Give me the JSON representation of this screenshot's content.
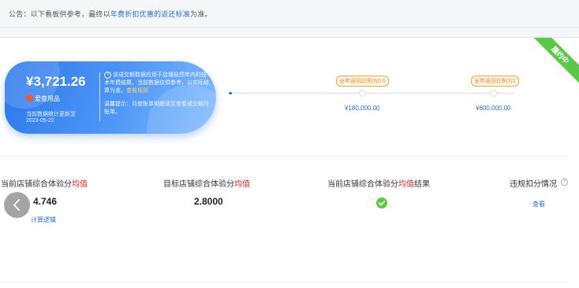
{
  "notice": {
    "prefix": "公告：以下看板供参考，最终以",
    "highlight": "年费折扣优惠的返还标准",
    "suffix": "为准。"
  },
  "ribbon": {
    "label": "履约中"
  },
  "card": {
    "amount": "¥3,721.26",
    "brand": "爱查用品",
    "update_line1": "当前数据统计更新至",
    "update_line2": "2023-05-22",
    "info_icon": "?",
    "description": "该成交额数据应用于店铺自然年内的技术年费结算。当前数据仅供参考，以实际结算为准。",
    "description_link": "查看规则",
    "tip": "温馨提示：月度账单明细请至查看成交额月账单。"
  },
  "progress": {
    "fill_ratio": 0.01,
    "milestones": [
      {
        "badge": "全年返回比例为0.5",
        "value": "¥180,000.00"
      },
      {
        "badge": "全年返回比例为1",
        "value": "¥600,000.00"
      }
    ]
  },
  "stats": [
    {
      "label_prefix": "当前店铺综合体验分",
      "label_highlight": "均值",
      "label_suffix": "",
      "value": "4.746",
      "link": "计算逻辑"
    },
    {
      "label_prefix": "目标店铺综合体验分",
      "label_highlight": "均值",
      "label_suffix": "",
      "value": "2.8000"
    },
    {
      "label_prefix": "当前店铺综合体验分",
      "label_highlight": "均值",
      "label_suffix": "结果",
      "status_icon": "check-circle-icon"
    },
    {
      "label_prefix": "违规扣分情况",
      "label_highlight": "",
      "label_suffix": "",
      "help_icon": "?",
      "link": "查看"
    }
  ],
  "colors": {
    "accent": "#2d6fd3",
    "success": "#5cc84a",
    "warning": "#f2a541",
    "danger": "#e02020"
  }
}
